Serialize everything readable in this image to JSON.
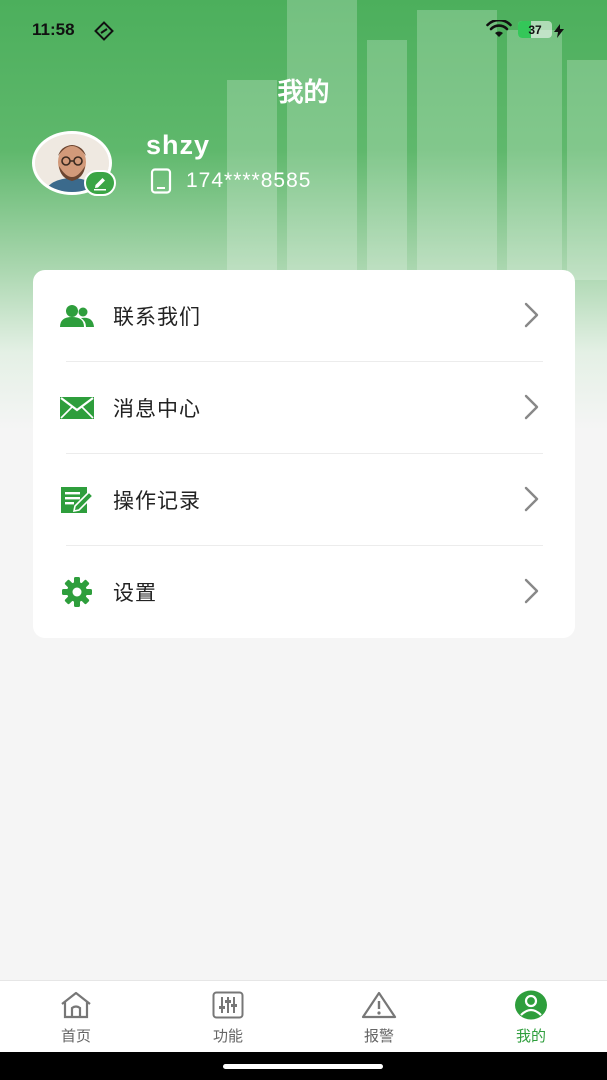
{
  "status_bar": {
    "time": "11:58",
    "battery": "37",
    "battery_level": 0.37
  },
  "header": {
    "title": "我的"
  },
  "profile": {
    "username": "shzy",
    "phone": "174****8585"
  },
  "menu": {
    "items": [
      {
        "label": "联系我们",
        "icon": "contacts-icon"
      },
      {
        "label": "消息中心",
        "icon": "mail-icon"
      },
      {
        "label": "操作记录",
        "icon": "edit-log-icon"
      },
      {
        "label": "设置",
        "icon": "gear-icon"
      }
    ]
  },
  "tabbar": {
    "tabs": [
      {
        "label": "首页",
        "icon": "home-icon",
        "active": false
      },
      {
        "label": "功能",
        "icon": "sliders-icon",
        "active": false
      },
      {
        "label": "报警",
        "icon": "warning-icon",
        "active": false
      },
      {
        "label": "我的",
        "icon": "user-icon",
        "active": true
      }
    ]
  },
  "colors": {
    "accent": "#2e9e3c",
    "header_green": "#4caf5c",
    "card": "#ffffff",
    "background": "#f5f5f5"
  }
}
